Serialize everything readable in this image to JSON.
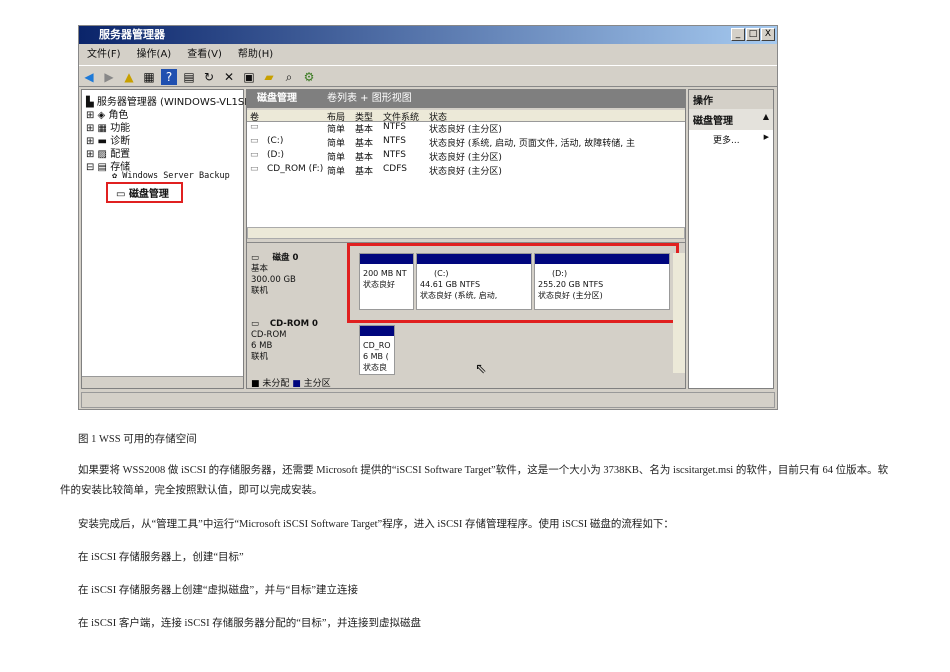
{
  "window": {
    "title": "服务器管理器",
    "minimize": "_",
    "maximize": "□",
    "close": "X"
  },
  "menu": [
    "文件(F)",
    "操作(A)",
    "查看(V)",
    "帮助(H)"
  ],
  "tree": {
    "root": "服务器管理器 (WINDOWS-VL1SLP",
    "items": [
      "角色",
      "功能",
      "诊断",
      "配置",
      "存储"
    ],
    "storage_children": [
      "Windows Server Backup",
      "磁盘管理"
    ]
  },
  "center": {
    "title": "磁盘管理",
    "view": "卷列表 + 图形视图",
    "columns": [
      "卷",
      "布局",
      "类型",
      "文件系统",
      "状态"
    ],
    "rows": [
      [
        "",
        "简单",
        "基本",
        "NTFS",
        "状态良好 (主分区)"
      ],
      [
        "(C:)",
        "简单",
        "基本",
        "NTFS",
        "状态良好 (系统, 启动, 页面文件, 活动, 故障转储, 主"
      ],
      [
        "(D:)",
        "简单",
        "基本",
        "NTFS",
        "状态良好 (主分区)"
      ],
      [
        "CD_ROM (F:)",
        "简单",
        "基本",
        "CDFS",
        "状态良好 (主分区)"
      ]
    ],
    "disks": [
      {
        "name": "磁盘 0",
        "type": "基本",
        "size": "300.00 GB",
        "status": "联机",
        "partitions": [
          {
            "label": "",
            "size": "200 MB NT",
            "state": "状态良好"
          },
          {
            "label": "(C:)",
            "size": "44.61 GB NTFS",
            "state": "状态良好 (系统, 启动,"
          },
          {
            "label": "(D:)",
            "size": "255.20 GB NTFS",
            "state": "状态良好 (主分区)"
          }
        ]
      },
      {
        "name": "CD-ROM 0",
        "type": "CD-ROM",
        "size": "6 MB",
        "status": "联机",
        "partitions": [
          {
            "label": "CD_RO",
            "size": "6 MB (",
            "state": "状态良"
          }
        ]
      }
    ],
    "legend": [
      "未分配",
      "主分区"
    ]
  },
  "actions": {
    "title": "操作",
    "section": "磁盘管理",
    "more": "更多..."
  },
  "colors": {
    "primary": "#00067e",
    "unallocated": "#000000",
    "highlight": "#e02020"
  },
  "doc": {
    "caption": "图 1   WSS 可用的存储空间",
    "p1a": "如果要将 WSS2008 做 iSCSI 的存储服务器，还需要 Microsoft 提供的“iSCSI Software Target”软件，这是一个大小为 3738KB、名为 iscsitarget.msi 的软件，目前只有 64 位版本。软",
    "p1b": "件的安装比较简单，完全按照默认值，即可以完成安装。",
    "p2": "安装完成后，从“管理工具”中运行“Microsoft iSCSI Software Target”程序，进入 iSCSI 存储管理程序。使用 iSCSI 磁盘的流程如下：",
    "s1": "在 iSCSI 存储服务器上，创建“目标”",
    "s2": "在 iSCSI 存储服务器上创建“虚拟磁盘”，并与“目标”建立连接",
    "s3": "在 iSCSI 客户端，连接 iSCSI 存储服务器分配的“目标”，并连接到虚拟磁盘"
  }
}
